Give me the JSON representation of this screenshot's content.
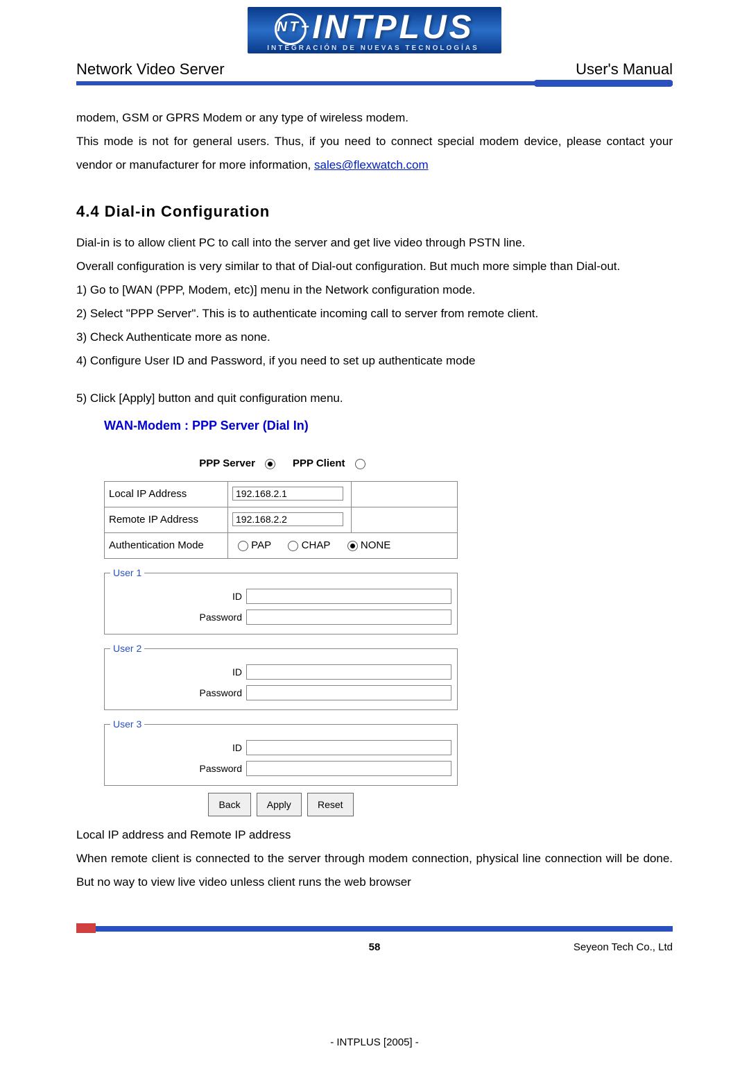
{
  "logo": {
    "name": "INTPLUS",
    "tag": "INTEGRACIÓN DE NUEVAS TECNOLOGÍAS",
    "badge": "NT+"
  },
  "header": {
    "left": "Network Video Server",
    "right": "User's Manual"
  },
  "intro": {
    "line1": "modem, GSM or GPRS Modem or any type of wireless modem.",
    "line2a": "This mode is not for general users. Thus, if you need to connect special modem device, please contact your vendor or manufacturer for more information, ",
    "email": "sales@flexwatch.com"
  },
  "section": {
    "num_title": "4.4 Dial-in Configuration",
    "p1": "Dial-in is to allow client PC to call into the server and get live video through PSTN line.",
    "p2": "Overall configuration is very similar to that of Dial-out configuration. But much more simple than Dial-out.",
    "steps": [
      "1)  Go to [WAN (PPP, Modem, etc)] menu in the Network configuration mode.",
      "2)  Select \"PPP Server\". This is to authenticate incoming call to server from remote client.",
      "3)  Check Authenticate more as none.",
      "4)  Configure User ID and Password, if you need to set up authenticate mode",
      "5)  Click [Apply] button and quit configuration menu."
    ]
  },
  "panel": {
    "title": "WAN-Modem : PPP Server (Dial In)",
    "mode_server": "PPP Server",
    "mode_client": "PPP Client",
    "rows": {
      "local_label": "Local IP Address",
      "local_value": "192.168.2.1",
      "remote_label": "Remote IP Address",
      "remote_value": "192.168.2.2",
      "auth_label": "Authentication Mode",
      "auth_pap": "PAP",
      "auth_chap": "CHAP",
      "auth_none": "NONE"
    },
    "users": [
      {
        "legend": "User 1",
        "id_label": "ID",
        "pw_label": "Password"
      },
      {
        "legend": "User 2",
        "id_label": "ID",
        "pw_label": "Password"
      },
      {
        "legend": "User 3",
        "id_label": "ID",
        "pw_label": "Password"
      }
    ],
    "buttons": {
      "back": "Back",
      "apply": "Apply",
      "reset": "Reset"
    }
  },
  "after": {
    "sub": "Local IP address and Remote IP address",
    "p": "When remote client is connected to the server through modem connection, physical line connection will be done. But no way to view live video unless client runs the web browser"
  },
  "footer": {
    "page": "58",
    "company": "Seyeon Tech Co., Ltd",
    "copyright": "- INTPLUS [2005] -"
  }
}
